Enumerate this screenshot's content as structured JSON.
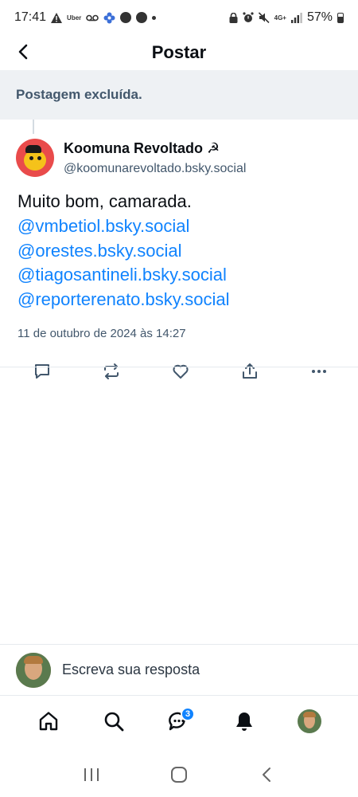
{
  "status_bar": {
    "time": "17:41",
    "uber_label": "Uber",
    "network": "4G+",
    "battery": "57%"
  },
  "header": {
    "title": "Postar"
  },
  "deleted_banner": {
    "text": "Postagem excluída."
  },
  "post": {
    "author_name": "Koomuna Revoltado ☭",
    "author_handle": "@koomunarevoltado.bsky.social",
    "text_prefix": "Muito bom, camarada. ",
    "mentions": [
      "@vmbetiol.bsky.social",
      "@orestes.bsky.social",
      "@tiagosantineli.bsky.social",
      "@reporterenato.bsky.social"
    ],
    "date": "11 de outubro de 2024 às 14:27"
  },
  "reply": {
    "placeholder": "Escreva sua resposta"
  },
  "nav": {
    "chat_badge": "3"
  },
  "colors": {
    "accent": "#1083fe",
    "banner_bg": "#eef1f4",
    "muted_text": "#42576c"
  },
  "icons": {
    "status": [
      "warning-icon",
      "voicemail-icon",
      "flower-icon",
      "smiley-icon",
      "smiley-icon",
      "dot-icon",
      "lock-icon",
      "alarm-icon",
      "mute-icon",
      "signal-icon",
      "battery-icon"
    ],
    "actions": [
      "reply-icon",
      "repost-icon",
      "like-icon",
      "share-icon",
      "more-icon"
    ],
    "nav": [
      "home-icon",
      "search-icon",
      "chat-icon",
      "notifications-icon",
      "profile-avatar"
    ],
    "system": [
      "recents-icon",
      "home-circle-icon",
      "system-back-icon"
    ]
  }
}
